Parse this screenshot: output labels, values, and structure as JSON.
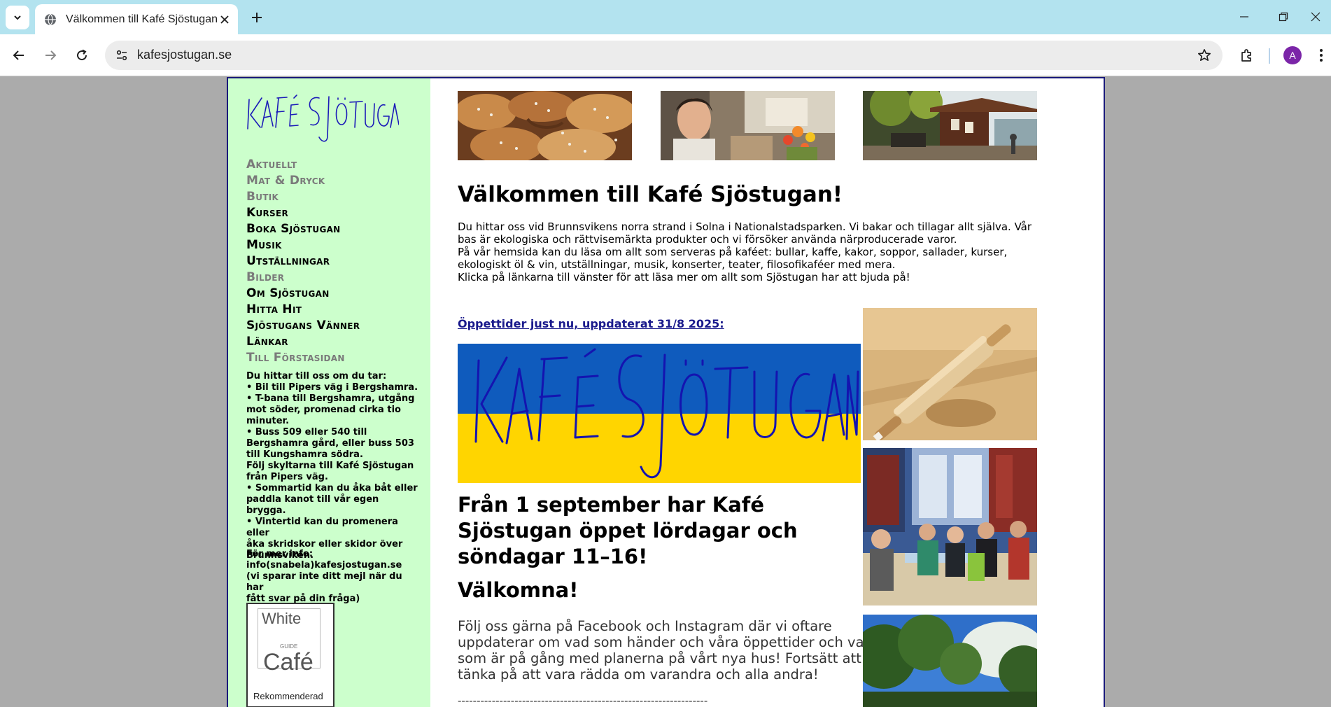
{
  "browser": {
    "tab_title": "Välkommen till Kafé Sjöstugan",
    "url": "kafesjostugan.se",
    "profile_initial": "A",
    "colors": {
      "tabbar": "#b3e3ef",
      "avatar": "#7b25a8"
    }
  },
  "site": {
    "logo_text": "Kafé Sjöstugan",
    "nav": [
      {
        "label": "Aktuellt",
        "style": "dim"
      },
      {
        "label": "Mat & Dryck",
        "style": "dim"
      },
      {
        "label": "Butik",
        "style": "dim"
      },
      {
        "label": "Kurser",
        "style": "dark"
      },
      {
        "label": "Boka Sjöstugan",
        "style": "dark"
      },
      {
        "label": "Musik",
        "style": "dark"
      },
      {
        "label": "Utställningar",
        "style": "dark"
      },
      {
        "label": "Bilder",
        "style": "dim"
      },
      {
        "label": "Om Sjöstugan",
        "style": "dark"
      },
      {
        "label": "Hitta Hit",
        "style": "dark"
      },
      {
        "label": "Sjöstugans Vänner",
        "style": "dark"
      },
      {
        "label": "Länkar",
        "style": "dark"
      },
      {
        "label": "Till Förstasidan",
        "style": "dim"
      }
    ],
    "directions": [
      "Du hittar till oss om du tar:",
      "• Bil till Pipers väg i Bergshamra.",
      "• T-bana till Bergshamra, utgång",
      "mot söder, promenad cirka tio",
      "minuter.",
      "• Buss 509 eller 540 till",
      "Bergshamra gård, eller buss 503",
      "till Kungshamra södra.",
      "Följ skyltarna till Kafé Sjöstugan",
      "från Pipers väg.",
      "• Sommartid kan du åka båt eller",
      "paddla kanot till vår egen brygga.",
      "• Vintertid kan du promenera eller",
      "åka skridskor eller skidor över",
      "Brunnsviken."
    ],
    "info": [
      "För mer info:",
      "info(snabela)kafesjostugan.se",
      "(vi sparar inte ditt mejl när du har",
      "fått svar på din fråga)"
    ],
    "badge": {
      "top": "White",
      "guide": "GUIDE",
      "cafe": "Café",
      "bottom": "Rekommenderad"
    },
    "colors": {
      "sidebar": "#ccffcc",
      "link": "#1a1a8c",
      "flag_blue": "#0f5bbd",
      "flag_yellow": "#ffd500"
    }
  },
  "main": {
    "welcome_heading": "Välkommen till Kafé Sjöstugan!",
    "intro": [
      "Du hittar oss vid Brunnsvikens norra strand i Solna i Nationalstadsparken. Vi bakar och tillagar allt själva. Vår",
      "bas är ekologiska och rättvisemärkta produkter och vi försöker använda närproducerade varor.",
      "På vår hemsida kan du läsa om allt som serveras på kaféet: bullar, kaffe, kakor, soppor, sallader, kurser,",
      "ekologiskt öl & vin, utställningar, musik, konserter, teater, filosofikaféer med mera.",
      "Klicka på länkarna till vänster för att läsa mer om allt som Sjöstugan har att bjuda på!"
    ],
    "hours_link": "Öppettider just nu, uppdaterat 31/8 2025:",
    "banner_text": "Kafé Sjöstugan",
    "announcement": [
      "Från 1 september har Kafé",
      "Sjöstugan öppet lördagar och",
      "söndagar 11–16!"
    ],
    "valkomna": "Välkomna!",
    "follow": [
      "Följ oss gärna på Facebook och Instagram där vi oftare",
      "uppdaterar om vad som händer och våra öppettider och vad",
      "som är på gång med planerna på vårt nya hus! Fortsätt att",
      "tänka på att vara rädda om varandra och alla andra!"
    ],
    "separator": "------------------------------------------------------------------"
  }
}
